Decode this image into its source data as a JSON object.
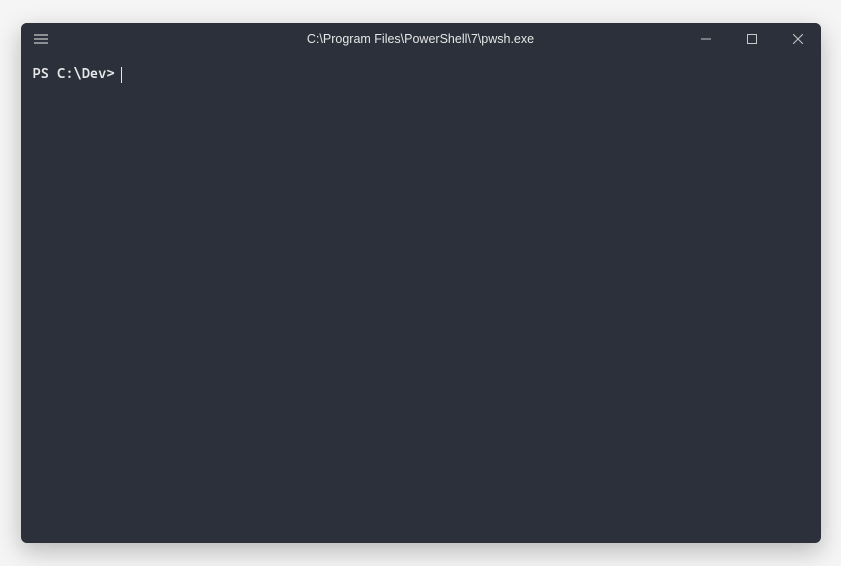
{
  "window": {
    "title": "C:\\Program Files\\PowerShell\\7\\pwsh.exe"
  },
  "terminal": {
    "prompt": "PS C:\\Dev>",
    "input": ""
  }
}
